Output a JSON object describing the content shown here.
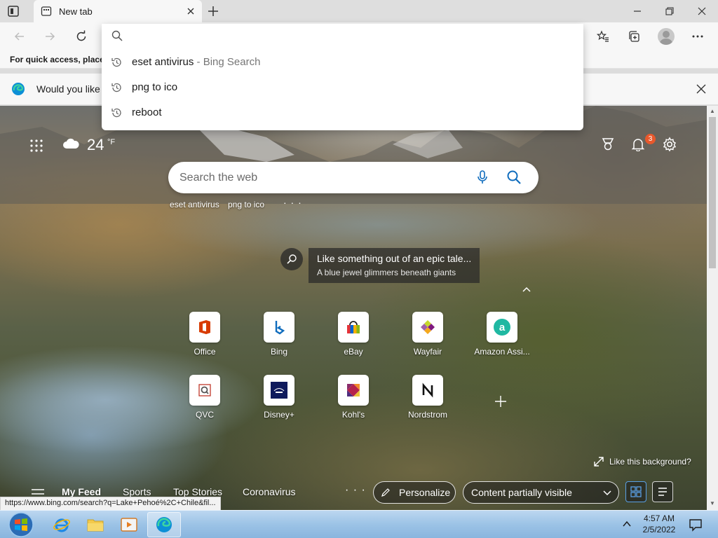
{
  "browser": {
    "tab_title": "New tab",
    "favorites_bar_text": "For quick access, place y",
    "infobar_text": "Would you like t",
    "address_value": ""
  },
  "omnibox": {
    "suggestions": [
      {
        "text": "eset antivirus",
        "extra": " - Bing Search"
      },
      {
        "text": "png to ico",
        "extra": ""
      },
      {
        "text": "reboot",
        "extra": ""
      }
    ]
  },
  "newtab": {
    "temperature": "24",
    "temp_unit": "°F",
    "notification_count": "3",
    "search_placeholder": "Search the web",
    "quick_searches": [
      "eset antivirus",
      "png to ico"
    ],
    "quick_more": "· · ·",
    "caption_title": "Like something out of an epic tale...",
    "caption_subtitle": "A blue jewel glimmers beneath giants",
    "tiles": [
      {
        "label": "Office",
        "icon": "office-icon"
      },
      {
        "label": "Bing",
        "icon": "bing-icon"
      },
      {
        "label": "eBay",
        "icon": "ebay-icon"
      },
      {
        "label": "Wayfair",
        "icon": "wayfair-icon"
      },
      {
        "label": "Amazon Assi...",
        "icon": "amazon-assistant-icon"
      },
      {
        "label": "QVC",
        "icon": "qvc-icon"
      },
      {
        "label": "Disney+",
        "icon": "disney-plus-icon"
      },
      {
        "label": "Kohl's",
        "icon": "kohls-icon"
      },
      {
        "label": "Nordstrom",
        "icon": "nordstrom-icon"
      }
    ],
    "like_background": "Like this background?",
    "feed_nav": [
      "My Feed",
      "Sports",
      "Top Stories",
      "Coronavirus"
    ],
    "feed_more": "· · ·",
    "personalize": "Personalize",
    "content_visibility": "Content partially visible"
  },
  "status_url": "https://www.bing.com/search?q=Lake+Pehoé%2C+Chile&fil...",
  "taskbar": {
    "time": "4:57 AM",
    "date": "2/5/2022"
  },
  "colors": {
    "edge_blue": "#0078d4",
    "notification_badge": "#e8582c",
    "taskbar": "#9cc3e6"
  }
}
